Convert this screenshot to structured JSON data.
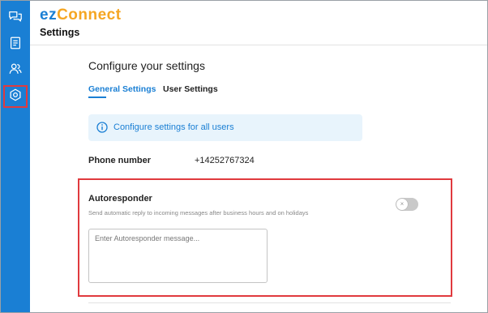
{
  "app": {
    "logo_prefix": "ez",
    "logo_suffix": "Connect",
    "page_title": "Settings"
  },
  "sidebar": {
    "items": [
      {
        "icon": "chat-icon",
        "active": false
      },
      {
        "icon": "document-icon",
        "active": false
      },
      {
        "icon": "users-icon",
        "active": false
      },
      {
        "icon": "gear-icon",
        "active": true
      }
    ]
  },
  "main": {
    "title": "Configure your settings",
    "tabs": [
      {
        "label": "General Settings",
        "active": true
      },
      {
        "label": "User Settings",
        "active": false
      }
    ],
    "info_banner": {
      "icon": "info-icon",
      "text": "Configure settings for all users"
    },
    "phone": {
      "label": "Phone number",
      "value": "+14252767324"
    },
    "autoresponder": {
      "title": "Autoresponder",
      "description": "Send automatic reply to incoming messages after business hours and on holidays",
      "toggle_on": false,
      "toggle_symbol": "×",
      "message_value": "",
      "message_placeholder": "Enter Autoresponder message..."
    }
  },
  "colors": {
    "accent": "#1a7fd4",
    "logo_secondary": "#f5a623",
    "highlight": "#e03a3e",
    "info_bg": "#e8f4fc"
  }
}
